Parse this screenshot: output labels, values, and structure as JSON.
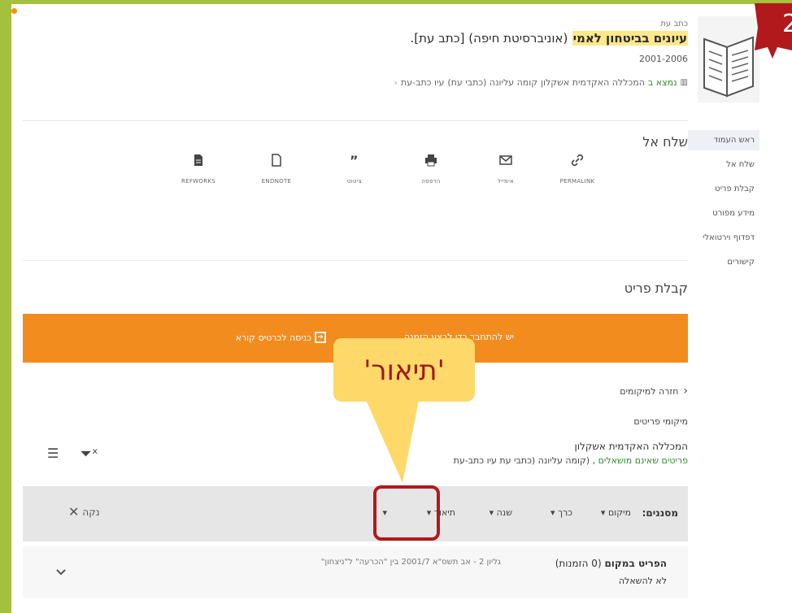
{
  "record": {
    "type": "כתב עת",
    "title_highlight": "עיונים בביטחון לאמי",
    "title_source": "(אוניברסיטת חיפה) [כתב עת].",
    "years": "2001-2006",
    "availability_prefix": "נמצא ב",
    "availability_location": "המכללה האקדמית אשקלון",
    "availability_rest": "קומה עליונה (כתבי עת)",
    "availability_shelf": "עיו כתב-עת"
  },
  "badge": {
    "number": "2",
    "color": "#b2191c"
  },
  "send_to": {
    "title": "שלח אל",
    "actions": [
      {
        "label": "PERMALINK",
        "icon": "link-icon"
      },
      {
        "label": "אימייל",
        "icon": "mail-icon"
      },
      {
        "label": "הדפסה",
        "icon": "print-icon"
      },
      {
        "label": "ציטוט",
        "icon": "quote-icon"
      },
      {
        "label": "ENDNOTE",
        "icon": "file-icon"
      },
      {
        "label": "REFWORKS",
        "icon": "file-filled-icon"
      }
    ]
  },
  "get_item": {
    "title": "קבלת פריט",
    "banner_msg": "יש להתחבר כדי לבצע הזמנה.",
    "banner_login": "כניסה לכרטיס קורא",
    "back_label": "חזרה למיקומים",
    "locations_label": "מיקומי פריטים",
    "location_name": "המכללה האקדמית אשקלון",
    "location_sub_green": "פריטים שאינם מושאלים",
    "location_sub_rest": ", (קומה עליונה (כתבי עת עיו כתב-עת"
  },
  "filters": {
    "label": "מסננים:",
    "items": [
      "מיקום",
      "כרך",
      "שנה",
      "תיאור"
    ],
    "clear_label": "נקה"
  },
  "item_row": {
    "status_prefix": "הפריט במקום",
    "status_count": "(0 הזמנות)",
    "description": "גליון 2 - אב תשס\"א 2001/7 בין \"הכרעה\" ל\"ניצחון\"",
    "loan_policy": "לא להשאלה"
  },
  "sidebar": {
    "items": [
      "ראש העמוד",
      "שלח אל",
      "קבלת פריט",
      "מידע מפורט",
      "דפדוף וירטואלי",
      "קישורים"
    ]
  },
  "callout": {
    "text": "'תיאור'"
  }
}
